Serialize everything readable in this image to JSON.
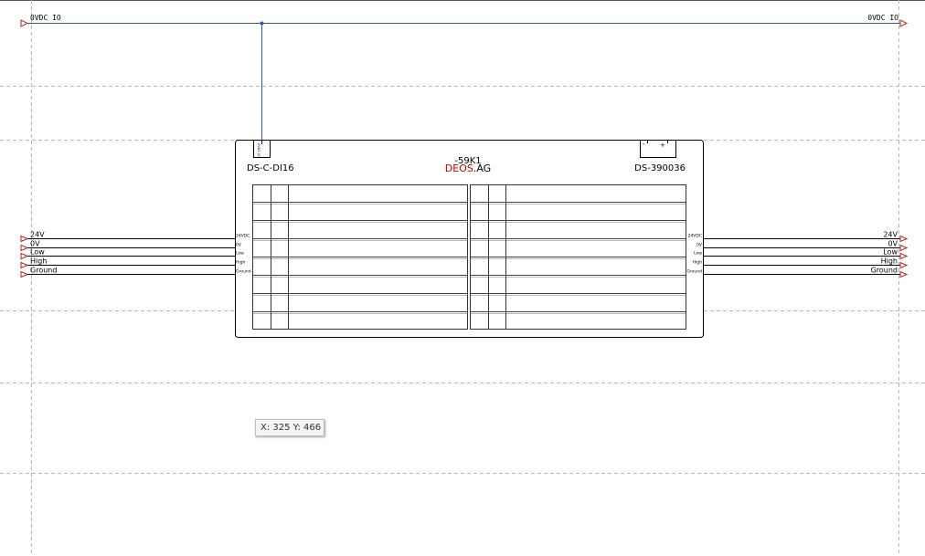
{
  "bus": {
    "left_label": "0VDC IO",
    "right_label": "0VDC IO"
  },
  "module": {
    "designation": "-59K1",
    "brand_red": "DEOS",
    "brand_suffix": ".AG",
    "left_model": "DS-C-DI16",
    "right_model": "DS-390036",
    "top_connector_label": "0VDC IO",
    "top_right_connector": {
      "minus": "-",
      "plus": "+"
    }
  },
  "left_port_labels": [
    "24VDC",
    "0V",
    "Low",
    "High",
    "Ground"
  ],
  "right_port_labels": [
    "24VDC",
    "0V",
    "Low",
    "High",
    "Ground"
  ],
  "left_signals": [
    "24V",
    "0V",
    "Low",
    "High",
    "Ground"
  ],
  "right_signals": [
    "24V",
    "0V",
    "Low",
    "High",
    "Ground"
  ],
  "terminal_table": {
    "rows": 8
  },
  "cursor_readout": "X: 325 Y: 466",
  "colors": {
    "bus_wire": "#2b5c9e",
    "signal_wire": "#000000",
    "brand_red": "#c00000",
    "arrow": "#b0281e",
    "grid": "#b8b8b8"
  }
}
